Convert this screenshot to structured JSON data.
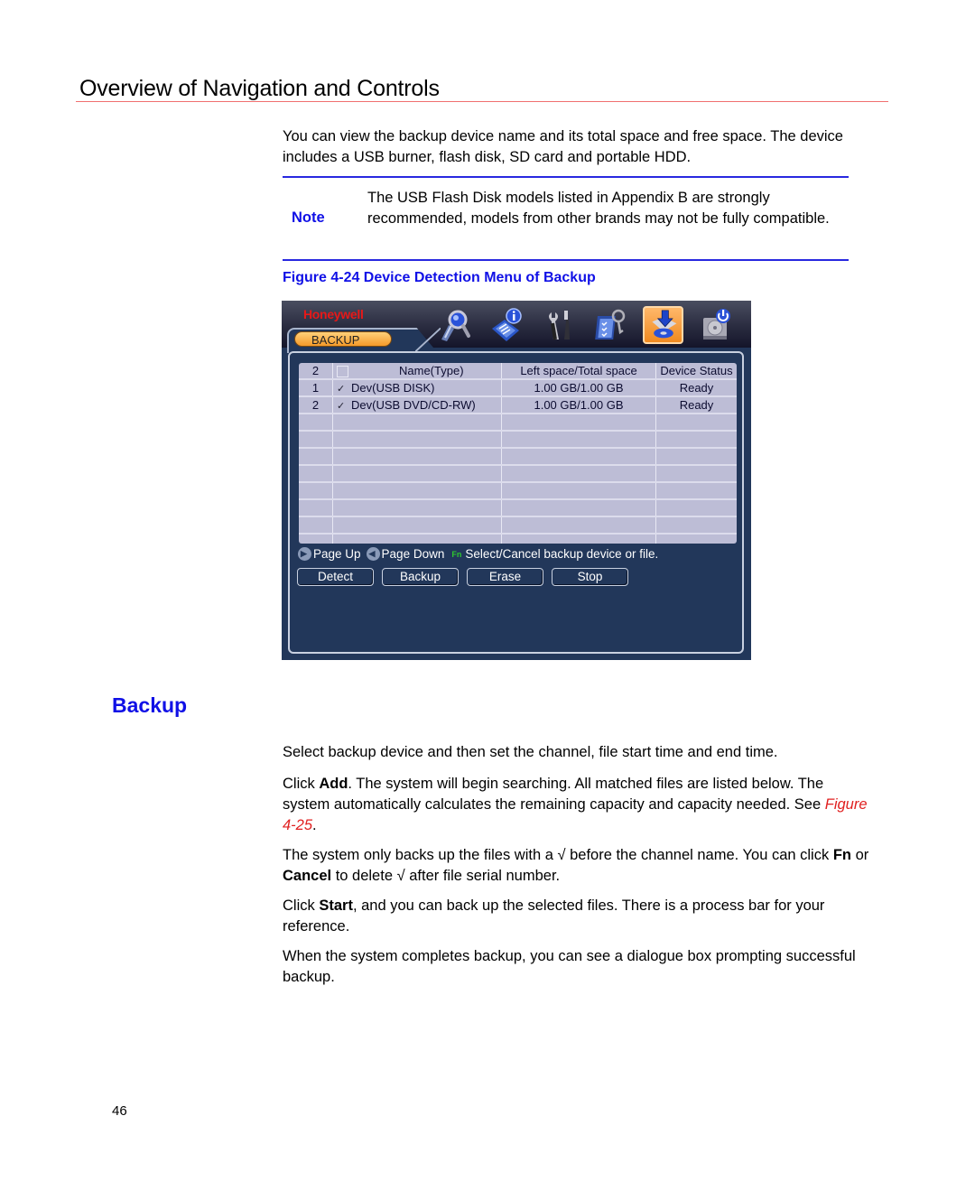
{
  "header": {
    "section_title": "Overview of Navigation and Controls"
  },
  "intro": {
    "text": "You can view the backup device name and its total space and free space. The device includes a USB burner, flash disk, SD card and portable HDD."
  },
  "note": {
    "label": "Note",
    "text": "The USB Flash Disk models listed in Appendix B are strongly recommended, models from other brands may not be fully compatible."
  },
  "figure": {
    "caption": "Figure 4-24 Device Detection Menu of Backup"
  },
  "dvr": {
    "logo": "Honeywell",
    "tab_label": "BACKUP",
    "toolbar_icons": [
      {
        "name": "search-icon",
        "active": false
      },
      {
        "name": "info-icon",
        "active": false
      },
      {
        "name": "tools-icon",
        "active": false
      },
      {
        "name": "checklist-icon",
        "active": false
      },
      {
        "name": "backup-icon",
        "active": true
      },
      {
        "name": "shutdown-icon",
        "active": false
      }
    ],
    "table": {
      "headers": {
        "count": "2",
        "name": "Name(Type)",
        "space": "Left space/Total space",
        "status": "Device Status"
      },
      "rows": [
        {
          "num": "1",
          "checked": "✓",
          "name": "Dev(USB DISK)",
          "space": "1.00 GB/1.00 GB",
          "status": "Ready"
        },
        {
          "num": "2",
          "checked": "✓",
          "name": "Dev(USB DVD/CD-RW)",
          "space": "1.00 GB/1.00 GB",
          "status": "Ready"
        }
      ],
      "empty_rows": 8
    },
    "hints": {
      "page_up": "Page Up",
      "page_down": "Page Down",
      "fn_key": "Fn",
      "fn_text": "Select/Cancel backup device or file."
    },
    "buttons": {
      "detect": "Detect",
      "backup": "Backup",
      "erase": "Erase",
      "stop": "Stop"
    }
  },
  "backup_section": {
    "title": "Backup",
    "p1": "Select backup device and then set the channel, file start time and end time.",
    "p2_pre": "Click ",
    "p2_bold": "Add",
    "p2_mid": ". The system will begin searching.  All matched files are listed below. The system automatically calculates the remaining capacity and capacity needed. See ",
    "p2_link": "Figure 4-25",
    "p2_end": ".",
    "p3_a": "The system only backs up the files with a  √  before the channel name. You can click ",
    "p3_b": "Fn",
    "p3_c": " or ",
    "p3_d": "Cancel",
    "p3_e": " to delete √ after file serial number.",
    "p4_a": "Click ",
    "p4_b": "Start",
    "p4_c": ", and you can back up the selected files. There is a process bar for your reference.",
    "p5": "When the system completes backup, you can see a dialogue box prompting successful backup."
  },
  "footer": {
    "page_number": "46"
  }
}
